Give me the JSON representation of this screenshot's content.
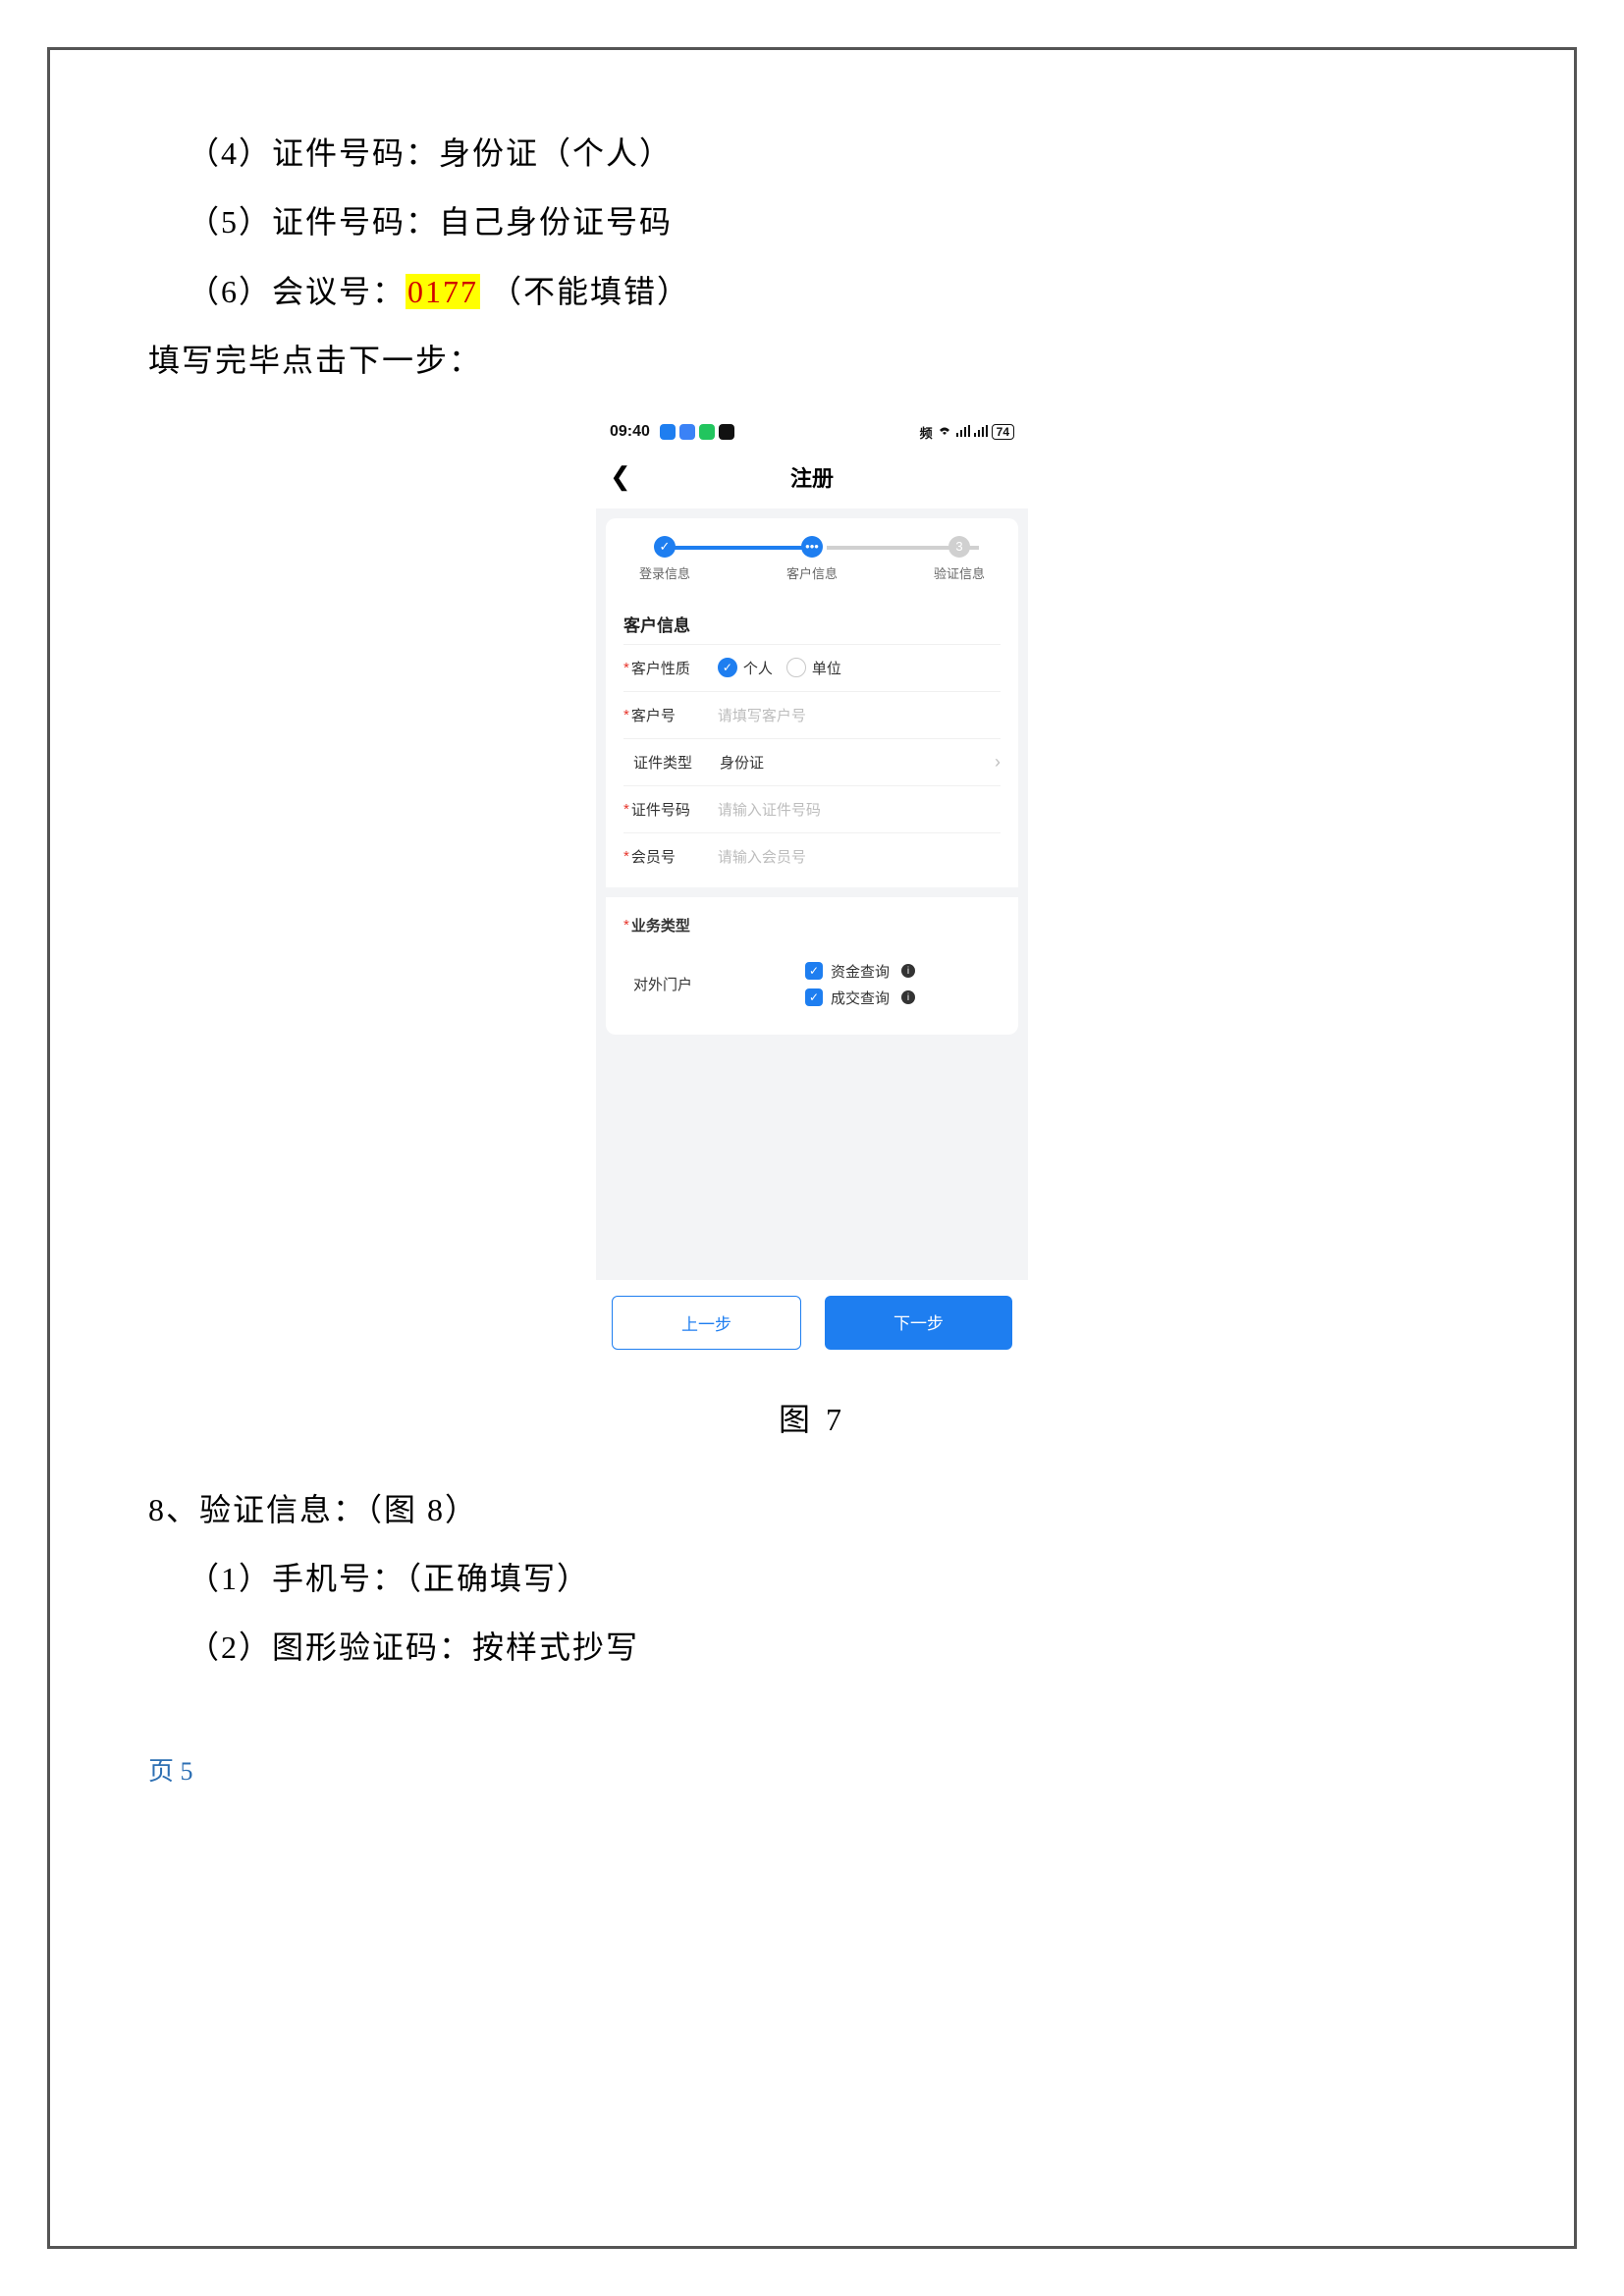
{
  "body": {
    "line4": "（4）证件号码：身份证（个人）",
    "line5": "（5）证件号码：自己身份证号码",
    "line6_prefix": "（6）会议号：",
    "line6_highlight": "0177",
    "line6_suffix": " （不能填错）",
    "next_step": "填写完毕点击下一步：",
    "figure_caption": "图 7",
    "line8": "8、验证信息：（图 8）",
    "line8_1": "（1）手机号：（正确填写）",
    "line8_2": "（2）图形验证码：按样式抄写"
  },
  "phone": {
    "time": "09:40",
    "battery": "74",
    "status_text": "频",
    "nav_title": "注册",
    "steps": {
      "s1": "登录信息",
      "s2": "客户信息",
      "s3": "验证信息"
    },
    "section_customer": "客户信息",
    "f_customer_type": {
      "label": "客户性质",
      "opt1": "个人",
      "opt2": "单位"
    },
    "f_customer_no": {
      "label": "客户号",
      "placeholder": "请填写客户号"
    },
    "f_id_type": {
      "label": "证件类型",
      "value": "身份证"
    },
    "f_id_no": {
      "label": "证件号码",
      "placeholder": "请输入证件号码"
    },
    "f_member_no": {
      "label": "会员号",
      "placeholder": "请输入会员号"
    },
    "section_biz": "业务类型",
    "f_portal": {
      "label": "对外门户",
      "chk1": "资金查询",
      "chk2": "成交查询"
    },
    "btn_prev": "上一步",
    "btn_next": "下一步"
  },
  "footer": {
    "page": "页 5"
  }
}
